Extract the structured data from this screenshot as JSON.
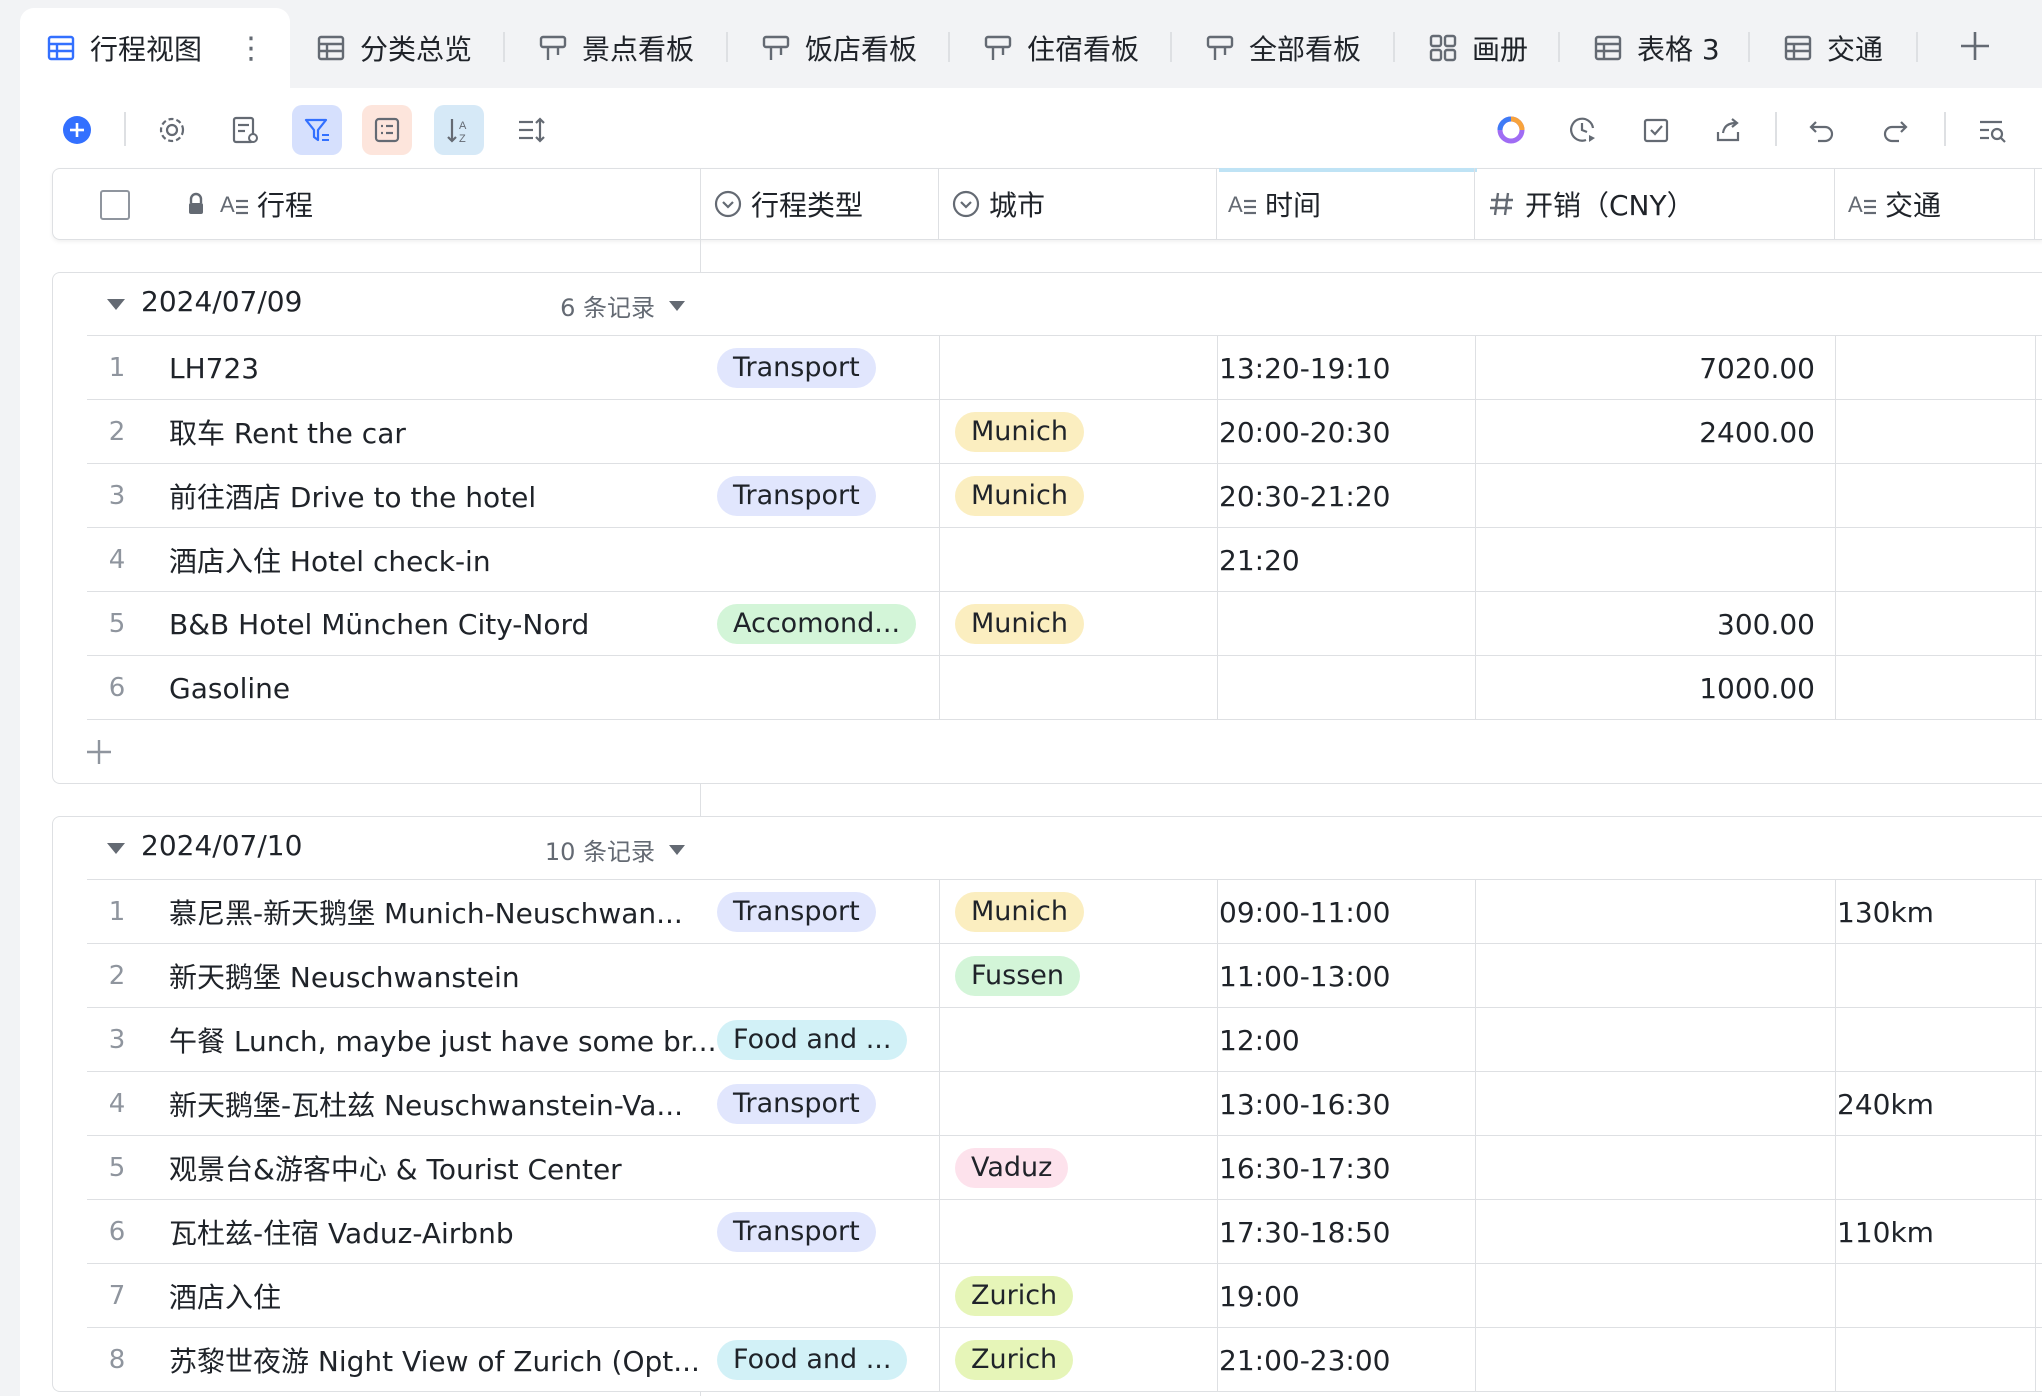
{
  "tabs": [
    {
      "label": "行程视图",
      "icon": "grid-table-icon"
    },
    {
      "label": "分类总览",
      "icon": "grid-table-icon"
    },
    {
      "label": "景点看板",
      "icon": "kanban-icon"
    },
    {
      "label": "饭店看板",
      "icon": "kanban-icon"
    },
    {
      "label": "住宿看板",
      "icon": "kanban-icon"
    },
    {
      "label": "全部看板",
      "icon": "kanban-icon"
    },
    {
      "label": "画册",
      "icon": "gallery-icon"
    },
    {
      "label": "表格 3",
      "icon": "grid-table-icon"
    },
    {
      "label": "交通",
      "icon": "grid-table-icon"
    }
  ],
  "active_tab_more": "⋮",
  "columns": {
    "trip": "行程",
    "type": "行程类型",
    "city": "城市",
    "time": "时间",
    "cost": "开销（CNY）",
    "transport": "交通"
  },
  "tag_colors": {
    "Transport": "#e1e6fd",
    "Accomond...": "#d3f5d8",
    "Food and ...": "#d2f1f7",
    "Munich": "#fbeec0",
    "Fussen": "#d3f5d8",
    "Vaduz": "#fde2ec",
    "Zurich": "#e6f5b8"
  },
  "groups": [
    {
      "date": "2024/07/09",
      "count": "6 条记录",
      "rows": [
        {
          "idx": "1",
          "trip": "LH723",
          "type": "Transport",
          "city": "",
          "time": "13:20-19:10",
          "cost": "7020.00",
          "transport": ""
        },
        {
          "idx": "2",
          "trip": "取车 Rent the car",
          "type": "",
          "city": "Munich",
          "time": "20:00-20:30",
          "cost": "2400.00",
          "transport": ""
        },
        {
          "idx": "3",
          "trip": "前往酒店 Drive to the hotel",
          "type": "Transport",
          "city": "Munich",
          "time": "20:30-21:20",
          "cost": "",
          "transport": ""
        },
        {
          "idx": "4",
          "trip": "酒店入住 Hotel check-in",
          "type": "",
          "city": "",
          "time": "21:20",
          "cost": "",
          "transport": ""
        },
        {
          "idx": "5",
          "trip": "B&B Hotel München City-Nord",
          "type": "Accomond...",
          "city": "Munich",
          "time": "",
          "cost": "300.00",
          "transport": ""
        },
        {
          "idx": "6",
          "trip": "Gasoline",
          "type": "",
          "city": "",
          "time": "",
          "cost": "1000.00",
          "transport": ""
        }
      ]
    },
    {
      "date": "2024/07/10",
      "count": "10 条记录",
      "rows": [
        {
          "idx": "1",
          "trip": "慕尼黑-新天鹅堡 Munich-Neuschwan...",
          "type": "Transport",
          "city": "Munich",
          "time": "09:00-11:00",
          "cost": "",
          "transport": "130km"
        },
        {
          "idx": "2",
          "trip": "新天鹅堡 Neuschwanstein",
          "type": "",
          "city": "Fussen",
          "time": "11:00-13:00",
          "cost": "",
          "transport": ""
        },
        {
          "idx": "3",
          "trip": "午餐 Lunch, maybe just have some br...",
          "type": "Food and ...",
          "city": "",
          "time": "12:00",
          "cost": "",
          "transport": ""
        },
        {
          "idx": "4",
          "trip": "新天鹅堡-瓦杜兹 Neuschwanstein-Va...",
          "type": "Transport",
          "city": "",
          "time": "13:00-16:30",
          "cost": "",
          "transport": "240km"
        },
        {
          "idx": "5",
          "trip": "观景台&游客中心 & Tourist Center",
          "type": "",
          "city": "Vaduz",
          "time": "16:30-17:30",
          "cost": "",
          "transport": ""
        },
        {
          "idx": "6",
          "trip": "瓦杜兹-住宿 Vaduz-Airbnb",
          "type": "Transport",
          "city": "",
          "time": "17:30-18:50",
          "cost": "",
          "transport": "110km"
        },
        {
          "idx": "7",
          "trip": "酒店入住",
          "type": "",
          "city": "Zurich",
          "time": "19:00",
          "cost": "",
          "transport": ""
        },
        {
          "idx": "8",
          "trip": "苏黎世夜游 Night View of Zurich (Opt...",
          "type": "Food and ...",
          "city": "Zurich",
          "time": "21:00-23:00",
          "cost": "",
          "transport": ""
        }
      ]
    }
  ]
}
